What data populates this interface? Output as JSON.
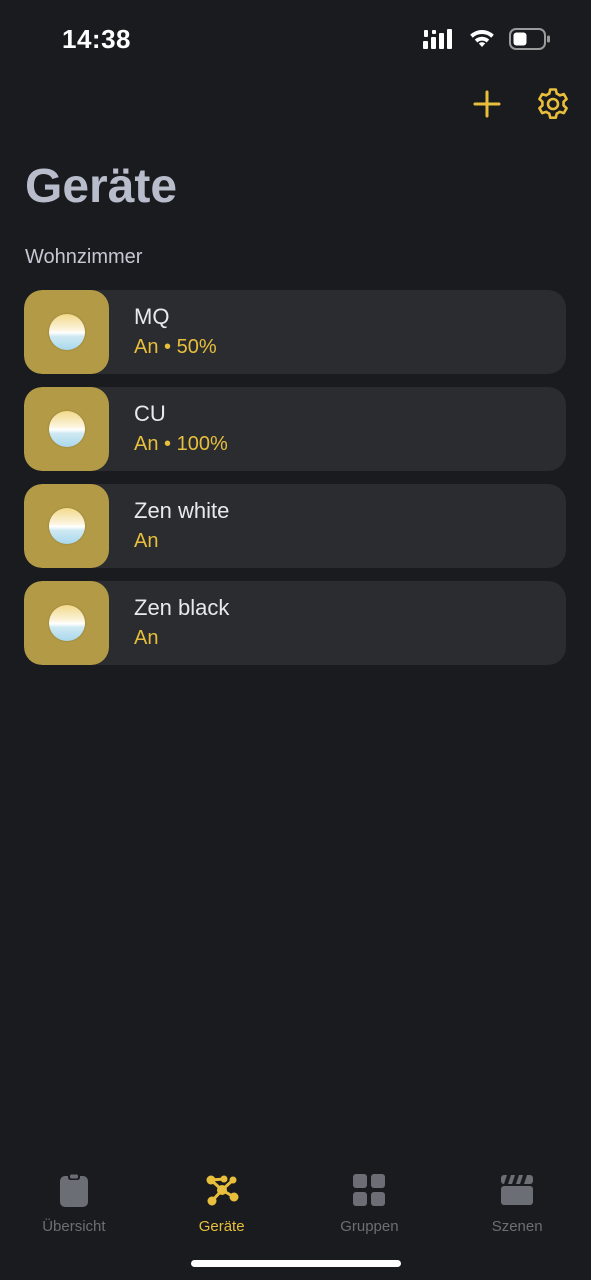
{
  "status_bar": {
    "time": "14:38"
  },
  "header": {
    "add_icon": "plus-icon",
    "settings_icon": "gear-icon",
    "title": "Geräte"
  },
  "section": {
    "label": "Wohnzimmer"
  },
  "devices": [
    {
      "name": "MQ",
      "status": "An • 50%"
    },
    {
      "name": "CU",
      "status": "An • 100%"
    },
    {
      "name": "Zen white",
      "status": "An"
    },
    {
      "name": "Zen black",
      "status": "An"
    }
  ],
  "tabs": [
    {
      "label": "Übersicht",
      "icon": "clipboard-icon",
      "active": false
    },
    {
      "label": "Geräte",
      "icon": "network-nodes-icon",
      "active": true
    },
    {
      "label": "Gruppen",
      "icon": "grid-icon",
      "active": false
    },
    {
      "label": "Szenen",
      "icon": "clapperboard-icon",
      "active": false
    }
  ],
  "colors": {
    "background": "#1a1b1e",
    "card": "#2b2c2f",
    "accent": "#e8bf3c",
    "icon_tile": "#b39a46",
    "title": "#b9bdcb",
    "tab_inactive": "#6c6e75"
  }
}
